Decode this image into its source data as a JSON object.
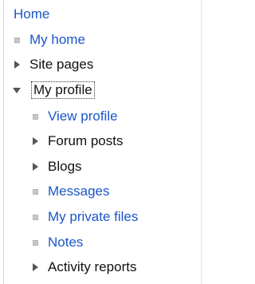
{
  "nav": {
    "home": "Home",
    "items": [
      {
        "label": "My home",
        "type": "link",
        "icon": "bullet-icon"
      },
      {
        "label": "Site pages",
        "type": "branch-collapsed",
        "icon": "triangle-right-icon"
      },
      {
        "label": "My profile",
        "type": "branch-expanded",
        "icon": "triangle-down-icon"
      }
    ],
    "profile_children": [
      {
        "label": "View profile",
        "type": "link",
        "icon": "bullet-icon"
      },
      {
        "label": "Forum posts",
        "type": "branch-collapsed",
        "icon": "triangle-right-icon"
      },
      {
        "label": "Blogs",
        "type": "branch-collapsed",
        "icon": "triangle-right-icon"
      },
      {
        "label": "Messages",
        "type": "link",
        "icon": "bullet-icon"
      },
      {
        "label": "My private files",
        "type": "link",
        "icon": "bullet-icon"
      },
      {
        "label": "Notes",
        "type": "link",
        "icon": "bullet-icon"
      },
      {
        "label": "Activity reports",
        "type": "branch-collapsed",
        "icon": "triangle-right-icon"
      }
    ]
  },
  "colors": {
    "link": "#1a56c8",
    "text": "#111111",
    "bullet": "#c7c7c7",
    "triangle": "#555555"
  }
}
